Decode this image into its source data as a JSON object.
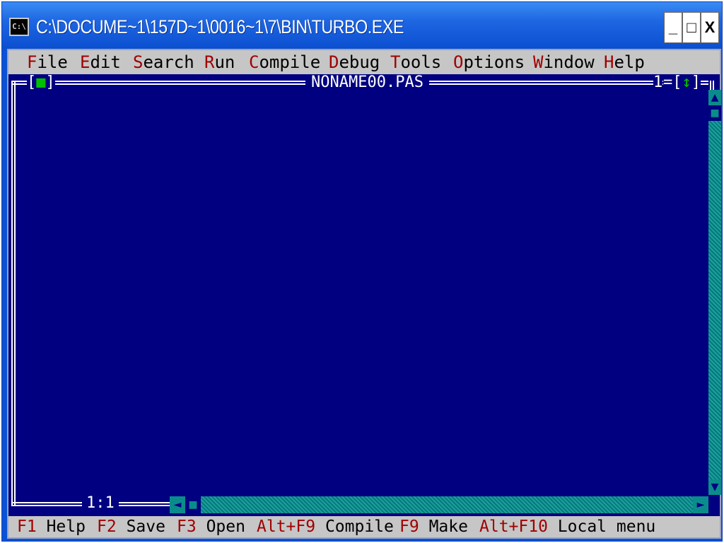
{
  "window": {
    "icon_text": "C:\\",
    "title": "C:\\DOCUME~1\\157D~1\\0016~1\\7\\BIN\\TURBO.EXE",
    "controls": {
      "minimize": "_",
      "maximize": "□",
      "close": "X"
    }
  },
  "menu": [
    {
      "hot": "F",
      "rest": "ile"
    },
    {
      "hot": "E",
      "rest": "dit"
    },
    {
      "hot": "S",
      "rest": "earch"
    },
    {
      "hot": "R",
      "rest": "un"
    },
    {
      "hot": "C",
      "rest": "ompile"
    },
    {
      "hot": "D",
      "rest": "ebug"
    },
    {
      "hot": "T",
      "rest": "ools"
    },
    {
      "hot": "O",
      "rest": "ptions"
    },
    {
      "hot": "W",
      "rest": "indow"
    },
    {
      "hot": "H",
      "rest": "elp"
    }
  ],
  "editor": {
    "close_box_open": "[",
    "close_box_mark": "■",
    "close_box_close": "]",
    "filename": "NONAME00.PAS",
    "window_number": "1",
    "zoom_open": "=[",
    "zoom_mark": "↕",
    "zoom_close": "]",
    "cursor_position": "1:1"
  },
  "scrollbars": {
    "up": "▲",
    "down": "▼",
    "left": "◄",
    "right": "►",
    "thumb": "■"
  },
  "statusbar": [
    {
      "key": "F1",
      "label": "Help"
    },
    {
      "key": "F2",
      "label": "Save"
    },
    {
      "key": "F3",
      "label": "Open"
    },
    {
      "key": "Alt+F9",
      "label": "Compile"
    },
    {
      "key": "F9",
      "label": "Make"
    },
    {
      "key": "Alt+F10",
      "label": "Local menu"
    }
  ],
  "colors": {
    "desktop": "#000080",
    "menu_bg": "#c6c6c6",
    "hotkey": "#a00000",
    "scrollbar": "#0b8c8c",
    "titlebar": "#0b4fd0"
  }
}
